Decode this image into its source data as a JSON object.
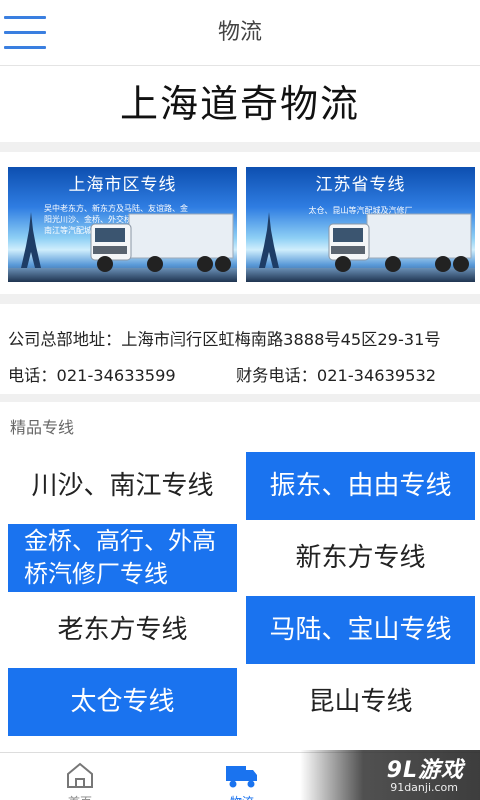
{
  "header": {
    "title": "物流"
  },
  "company": {
    "name": "上海道奇物流"
  },
  "banners": [
    {
      "title": "上海市区专线",
      "subtitle": "吴中老东方、新东方及马陆、友谊路、金阳光川沙、金桥、外交桥、振东、由由、南江等汽配城及汽修厂"
    },
    {
      "title": "江苏省专线",
      "subtitle": "太仓、昆山等汽配城及汽修厂"
    }
  ],
  "info": {
    "address": "公司总部地址：上海市闫行区虹梅南路3888号45区29-31号",
    "phone": "电话：021-34633599",
    "finance_phone": "财务电话：021-34639532"
  },
  "routes": {
    "heading": "精品专线",
    "items": [
      {
        "label": "川沙、南江专线"
      },
      {
        "label": "振东、由由专线"
      },
      {
        "label": "金桥、高行、外高桥汽修厂专线"
      },
      {
        "label": "新东方专线"
      },
      {
        "label": "老东方专线"
      },
      {
        "label": "马陆、宝山专线"
      },
      {
        "label": "太仓专线"
      },
      {
        "label": "昆山专线"
      }
    ]
  },
  "tabbar": {
    "tabs": [
      {
        "label": "首页",
        "icon": "home-icon"
      },
      {
        "label": "物流",
        "icon": "truck-icon"
      }
    ]
  },
  "watermark": {
    "logo": "9L游戏",
    "url": "91danji.com"
  },
  "colors": {
    "accent": "#1a73ef",
    "menu": "#3a7fe0"
  }
}
